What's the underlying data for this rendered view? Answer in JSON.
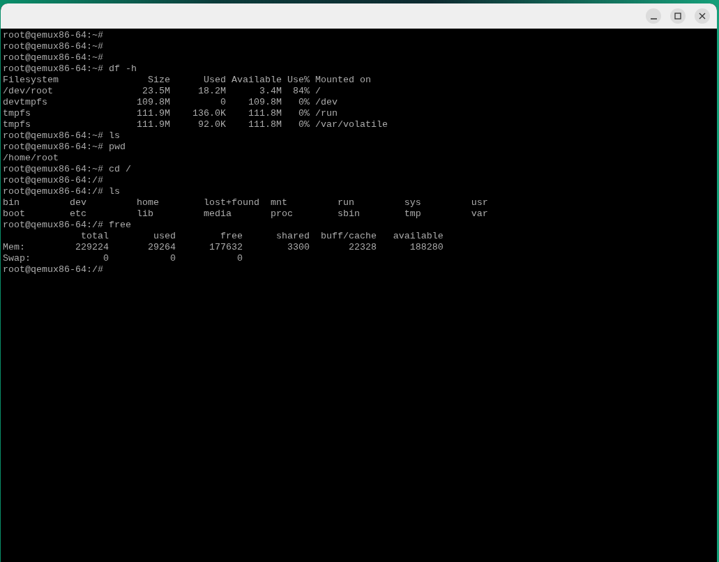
{
  "window": {
    "controls": [
      {
        "kind": "minimize"
      },
      {
        "kind": "maximize"
      },
      {
        "kind": "close"
      }
    ]
  },
  "terminal": {
    "lines": [
      "root@qemux86-64:~#",
      "root@qemux86-64:~#",
      "root@qemux86-64:~#",
      "root@qemux86-64:~# df -h",
      "Filesystem                Size      Used Available Use% Mounted on",
      "/dev/root                23.5M     18.2M      3.4M  84% /",
      "devtmpfs                109.8M         0    109.8M   0% /dev",
      "tmpfs                   111.9M    136.0K    111.8M   0% /run",
      "tmpfs                   111.9M     92.0K    111.8M   0% /var/volatile",
      "root@qemux86-64:~# ls",
      "root@qemux86-64:~# pwd",
      "/home/root",
      "root@qemux86-64:~# cd /",
      "root@qemux86-64:/#",
      "root@qemux86-64:/# ls",
      "bin         dev         home        lost+found  mnt         run         sys         usr",
      "boot        etc         lib         media       proc        sbin        tmp         var",
      "root@qemux86-64:/# free",
      "              total        used        free      shared  buff/cache   available",
      "Mem:         229224       29264      177632        3300       22328      188280",
      "Swap:             0           0           0",
      "root@qemux86-64:/#"
    ]
  }
}
